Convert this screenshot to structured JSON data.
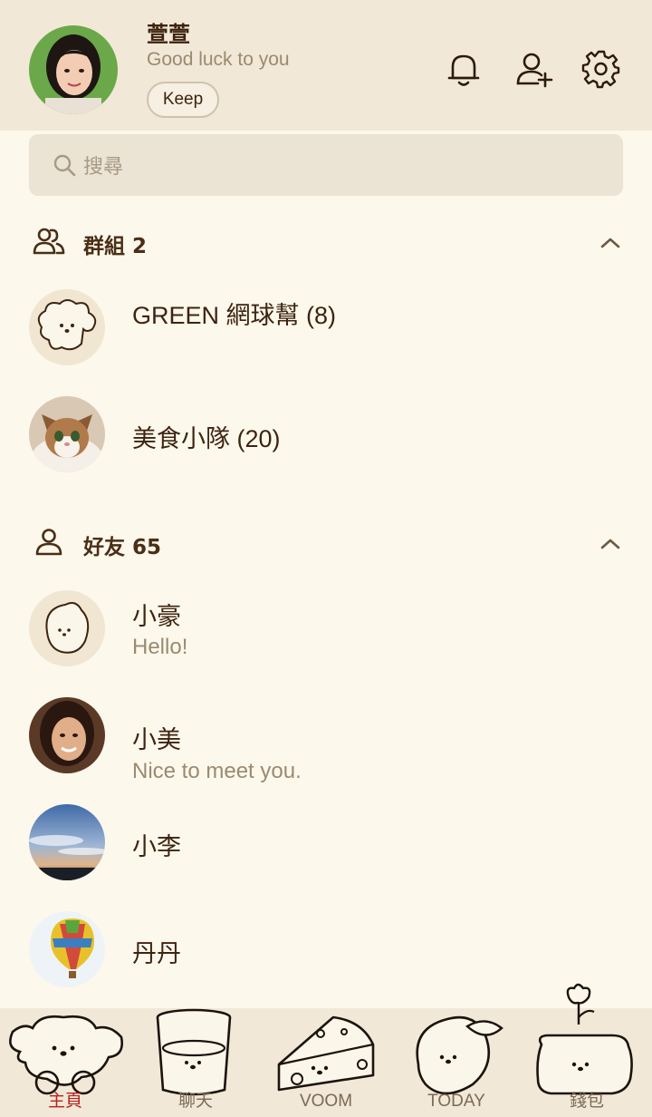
{
  "profile": {
    "name": "萱萱",
    "status": "Good luck to you",
    "keep_label": "Keep"
  },
  "header_icons": [
    "bell-icon",
    "add-friend-icon",
    "settings-icon"
  ],
  "search": {
    "placeholder": "搜尋"
  },
  "groups": {
    "title": "群組 2",
    "items": [
      {
        "name": "GREEN 網球幫 (8)",
        "avatar": "dog-illustration"
      },
      {
        "name": "美食小隊 (20)",
        "avatar": "cat-photo"
      }
    ]
  },
  "friends": {
    "title": "好友 65",
    "items": [
      {
        "name": "小豪",
        "message": "Hello!",
        "avatar": "lemon-illustration"
      },
      {
        "name": "小美",
        "message": "Nice to meet you.",
        "avatar": "woman-photo"
      },
      {
        "name": "小李",
        "message": "",
        "avatar": "sky-photo"
      },
      {
        "name": "丹丹",
        "message": "",
        "avatar": "hot-air-balloon-photo"
      }
    ]
  },
  "tabs": [
    {
      "label": "主頁",
      "active": true
    },
    {
      "label": "聊天",
      "active": false
    },
    {
      "label": "VOOM",
      "active": false
    },
    {
      "label": "TODAY",
      "active": false
    },
    {
      "label": "錢包",
      "active": false
    }
  ],
  "colors": {
    "background": "#fdf8ec",
    "header": "#f1e8d7",
    "text": "#4a2e16",
    "muted": "#9b8a70",
    "active_tab": "#b8211c"
  }
}
